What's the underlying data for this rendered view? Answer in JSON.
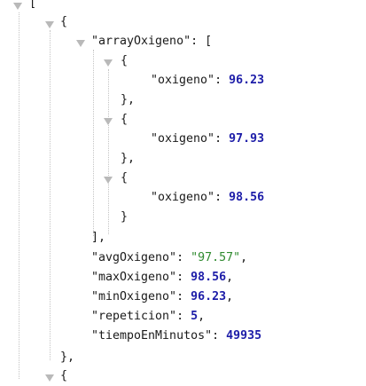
{
  "json": {
    "open_bracket": "[",
    "open_brace": "{",
    "close_brace": "}",
    "close_brace_comma": "},",
    "close_bracket_comma": "],",
    "colon": ": ",
    "comma": ",",
    "array_key": "\"arrayOxigeno\"",
    "array_open": "[",
    "items": [
      {
        "key": "\"oxigeno\"",
        "value": "96.23"
      },
      {
        "key": "\"oxigeno\"",
        "value": "97.93"
      },
      {
        "key": "\"oxigeno\"",
        "value": "98.56"
      }
    ],
    "fields": [
      {
        "key": "\"avgOxigeno\"",
        "value": "\"97.57\"",
        "trail": ","
      },
      {
        "key": "\"maxOxigeno\"",
        "value": "98.56",
        "trail": ","
      },
      {
        "key": "\"minOxigeno\"",
        "value": "96.23",
        "trail": ","
      },
      {
        "key": "\"repeticion\"",
        "value": "5",
        "trail": ","
      },
      {
        "key": "\"tiempoEnMinutos\"",
        "value": "49935",
        "trail": ""
      }
    ]
  }
}
